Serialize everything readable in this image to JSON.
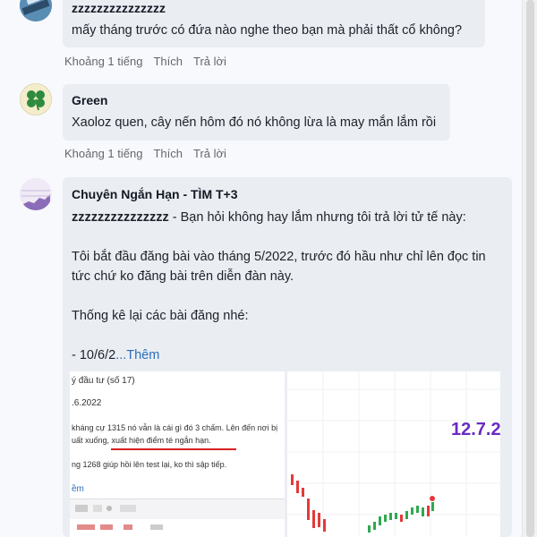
{
  "comments": [
    {
      "author": "zzzzzzzzzzzzzzz",
      "text": "mấy tháng trước có đứa nào nghe theo bạn mà phải thất cổ không?",
      "actions": [
        "Khoảng 1 tiếng",
        "Thích",
        "Trả lời"
      ]
    },
    {
      "author": "Green",
      "text": "Xaoloz quen, cây nến hôm đó nó không lừa là may mắn lắm rồi",
      "actions": [
        "Khoảng 1 tiếng",
        "Thích",
        "Trả lời"
      ]
    }
  ],
  "post": {
    "author": "Chuyên Ngắn Hạn - TÌM T+3",
    "reply_to": "zzzzzzzzzzzzzzz",
    "reply_rest": " - Bạn hỏi không hay lắm nhưng tôi trả lời tử tế này:",
    "line2": "Tôi bắt đầu đăng bài vào tháng 5/2022, trước đó hầu như chỉ lên đọc tin",
    "line3": "tức chứ ko đăng bài trên diễn đàn này.",
    "line4": "Thống kê lại các bài đăng nhé:",
    "line5": "- 10/6/2",
    "more": "...Thêm"
  },
  "screenshot_left": {
    "l1": "ý đầu tư (số 17)",
    "l2": ".6.2022",
    "l3": "kháng cự 1315 nó vẫn là cái gì đó 3 chấm. Lên đến nơi bị",
    "l4a": "uất xuống,",
    "l4b": " xuất hiện điểm té ngắn hạn.",
    "l5": "ng 1268 giúp hồi lên test lại, ko thì sập tiếp.",
    "l6": "ềm"
  },
  "screenshot_right": {
    "date": "12.7.2"
  },
  "colors": {
    "bubble": "#eaeef3",
    "link": "#2a6ebb",
    "date_purple": "#6a2bc2",
    "candle_red": "#e33a3a",
    "candle_green": "#2fa84f"
  }
}
